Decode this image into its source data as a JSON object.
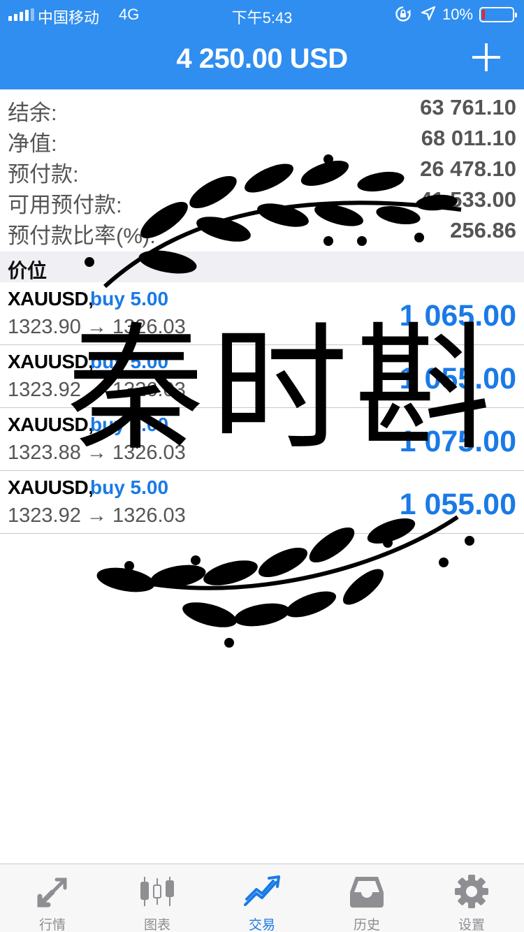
{
  "status_bar": {
    "carrier": "中国移动",
    "network": "4G",
    "time": "下午5:43",
    "battery": "10%",
    "icons": [
      "signal-icon",
      "orientation-lock-icon",
      "location-icon",
      "battery-icon"
    ]
  },
  "header": {
    "title": "4 250.00 USD",
    "add_icon": "plus-icon"
  },
  "summary": [
    {
      "label": "结余:",
      "value": "63 761.10"
    },
    {
      "label": "净值:",
      "value": "68 011.10"
    },
    {
      "label": "预付款:",
      "value": "26 478.10"
    },
    {
      "label": "可用预付款:",
      "value": "41 533.00"
    },
    {
      "label": "预付款比率(%):",
      "value": "256.86"
    }
  ],
  "positions_section": {
    "title": "价位"
  },
  "positions": [
    {
      "symbol": "XAUUSD,",
      "side": "buy 5.00",
      "prices": "1323.90 → 1326.03",
      "profit": "1 065.00"
    },
    {
      "symbol": "XAUUSD,",
      "side": "buy 5.00",
      "prices": "1323.92 → 1326.03",
      "profit": "1 055.00"
    },
    {
      "symbol": "XAUUSD,",
      "side": "buy 5.00",
      "prices": "1323.88 → 1326.03",
      "profit": "1 075.00"
    },
    {
      "symbol": "XAUUSD,",
      "side": "buy 5.00",
      "prices": "1323.92 → 1326.03",
      "profit": "1 055.00"
    }
  ],
  "watermark": {
    "text": "秦时斟"
  },
  "tabbar": {
    "active": "交易",
    "tabs": [
      {
        "label": "行情",
        "icon": "quotes-arrows-icon"
      },
      {
        "label": "图表",
        "icon": "candlestick-chart-icon"
      },
      {
        "label": "交易",
        "icon": "trade-trend-icon"
      },
      {
        "label": "历史",
        "icon": "history-inbox-icon"
      },
      {
        "label": "设置",
        "icon": "gear-icon"
      }
    ]
  },
  "colors": {
    "header_bg": "#2f8ef0",
    "accent_blue": "#1a7ae6",
    "battery_low": "#e8262b",
    "section_bg": "#efeff4",
    "tab_inactive": "#8e8e93"
  }
}
